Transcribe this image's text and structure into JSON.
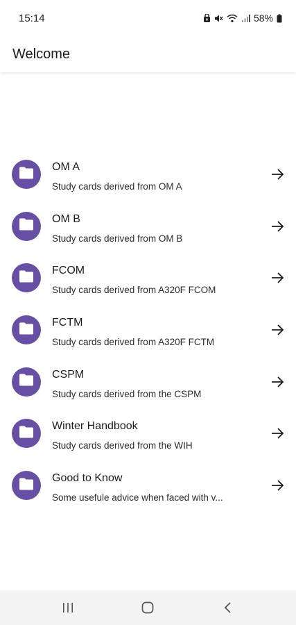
{
  "status_bar": {
    "time": "15:14",
    "battery": "58%",
    "icons": [
      "silent-mode-icon",
      "mute-icon",
      "wifi-icon",
      "signal-icon",
      "battery-icon"
    ]
  },
  "app_bar": {
    "title": "Welcome"
  },
  "list": {
    "items": [
      {
        "title": "OM A",
        "subtitle": "Study cards derived from OM A",
        "icon": "folder-icon",
        "action_icon": "arrow-right-icon"
      },
      {
        "title": "OM B",
        "subtitle": "Study cards derived from OM B",
        "icon": "folder-icon",
        "action_icon": "arrow-right-icon"
      },
      {
        "title": "FCOM",
        "subtitle": "Study cards derived from A320F FCOM",
        "icon": "folder-icon",
        "action_icon": "arrow-right-icon"
      },
      {
        "title": "FCTM",
        "subtitle": "Study cards derived from A320F FCTM",
        "icon": "folder-icon",
        "action_icon": "arrow-right-icon"
      },
      {
        "title": "CSPM",
        "subtitle": "Study cards derived from the CSPM",
        "icon": "folder-icon",
        "action_icon": "arrow-right-icon"
      },
      {
        "title": "Winter Handbook",
        "subtitle": "Study cards derived from the WIH",
        "icon": "folder-icon",
        "action_icon": "arrow-right-icon"
      },
      {
        "title": "Good to Know",
        "subtitle": "Some usefule advice when faced with v...",
        "icon": "folder-icon",
        "action_icon": "arrow-right-icon"
      }
    ]
  },
  "nav_bar": {
    "buttons": [
      "recent-apps-icon",
      "home-icon",
      "back-icon"
    ]
  },
  "colors": {
    "accent": "#6750a4",
    "background": "#ffffff",
    "nav_background": "#f3f3f3"
  }
}
